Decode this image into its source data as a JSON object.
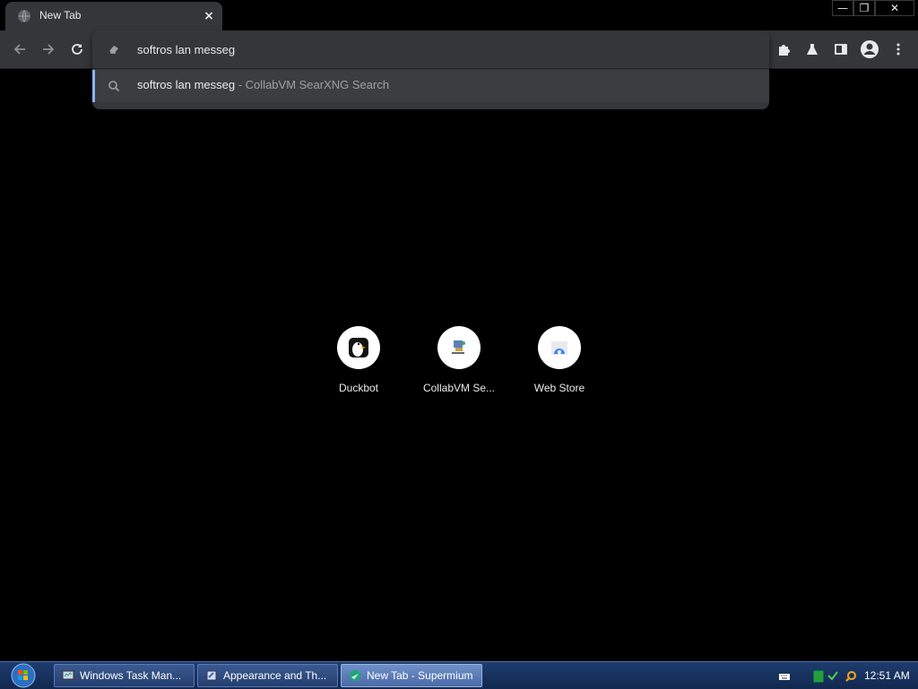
{
  "tab": {
    "title": "New Tab",
    "close": "×"
  },
  "window_controls": {
    "minimize": "—",
    "maximize": "❐",
    "close": "✕"
  },
  "omnibox": {
    "value": "softros lan messeg",
    "suggestion": {
      "query": "softros lan messeg",
      "separator": " - ",
      "engine": "CollabVM SearXNG Search"
    }
  },
  "shortcuts": [
    {
      "label": "Duckbot"
    },
    {
      "label": "CollabVM Se..."
    },
    {
      "label": "Web Store"
    }
  ],
  "taskbar": {
    "tasks": [
      {
        "label": "Windows Task Man..."
      },
      {
        "label": "Appearance and Th..."
      },
      {
        "label": "New Tab - Supermium"
      }
    ],
    "clock": "12:51 AM"
  },
  "colors": {
    "accent": "#8ab4f8",
    "toolbar": "#35363a",
    "background": "#000000"
  }
}
